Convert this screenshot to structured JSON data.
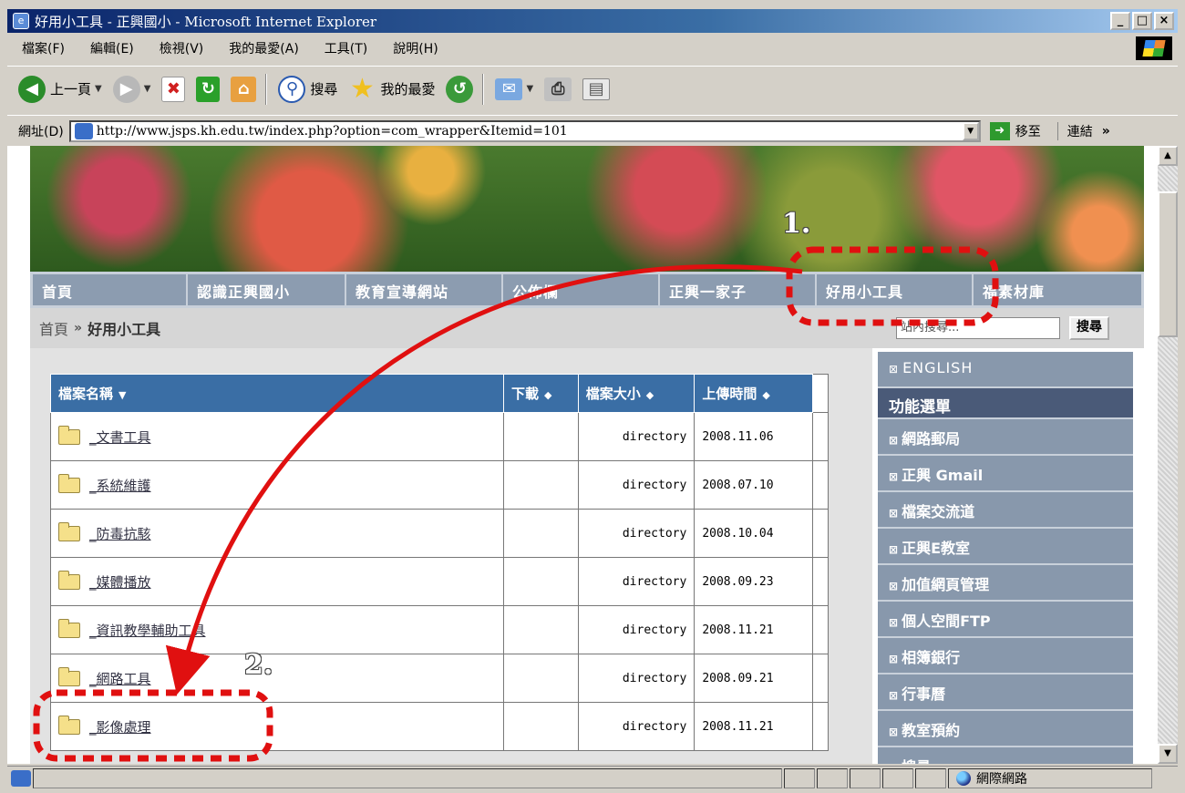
{
  "window": {
    "title": "好用小工具 - 正興國小 - Microsoft Internet Explorer",
    "app_icon": "e",
    "minimize": "_",
    "maximize": "□",
    "close": "×"
  },
  "menubar": {
    "items": [
      "檔案(F)",
      "編輯(E)",
      "檢視(V)",
      "我的最愛(A)",
      "工具(T)",
      "說明(H)"
    ]
  },
  "toolbar": {
    "back": "上一頁",
    "search": "搜尋",
    "favorites": "我的最愛"
  },
  "address": {
    "label": "網址(D)",
    "url": "http://www.jsps.kh.edu.tw/index.php?option=com_wrapper&Itemid=101",
    "go": "移至",
    "links": "連結"
  },
  "nav": {
    "items": [
      "首頁",
      "認識正興國小",
      "教育宣導網站",
      "公佈欄",
      "正興一家子",
      "好用小工具",
      "福素材庫"
    ]
  },
  "breadcrumb": {
    "home": "首頁",
    "sep": "»",
    "current": "好用小工具"
  },
  "search": {
    "placeholder": "站內搜尋...",
    "button": "搜尋"
  },
  "file_table": {
    "headers": {
      "name": "檔案名稱",
      "download": "下載",
      "size": "檔案大小",
      "date": "上傳時間"
    },
    "sort_desc": "▼",
    "sort_both": "◆",
    "rows": [
      {
        "name": "_文書工具",
        "size": "directory",
        "date": "2008.11.06"
      },
      {
        "name": "_系統維護",
        "size": "directory",
        "date": "2008.07.10"
      },
      {
        "name": "_防毒抗駭",
        "size": "directory",
        "date": "2008.10.04"
      },
      {
        "name": "_媒體播放",
        "size": "directory",
        "date": "2008.09.23"
      },
      {
        "name": "_資訊教學輔助工具",
        "size": "directory",
        "date": "2008.11.21"
      },
      {
        "name": "_網路工具",
        "size": "directory",
        "date": "2008.09.21"
      },
      {
        "name": "_影像處理",
        "size": "directory",
        "date": "2008.11.21"
      }
    ]
  },
  "sidebar": {
    "bullet": "⊠",
    "top_item": "ENGLISH",
    "header": "功能選單",
    "items": [
      "網路郵局",
      "正興 Gmail",
      "檔案交流道",
      "正興E教室",
      "加值網頁管理",
      "個人空間FTP",
      "相簿銀行",
      "行事曆",
      "教室預約",
      "搜尋"
    ]
  },
  "statusbar": {
    "zone": "網際網路"
  },
  "annotations": {
    "step1": "1.",
    "step2": "2."
  },
  "colors": {
    "annotation_red": "#e01010",
    "table_header": "#3a6ea5",
    "sidebar": "#8898ac"
  }
}
